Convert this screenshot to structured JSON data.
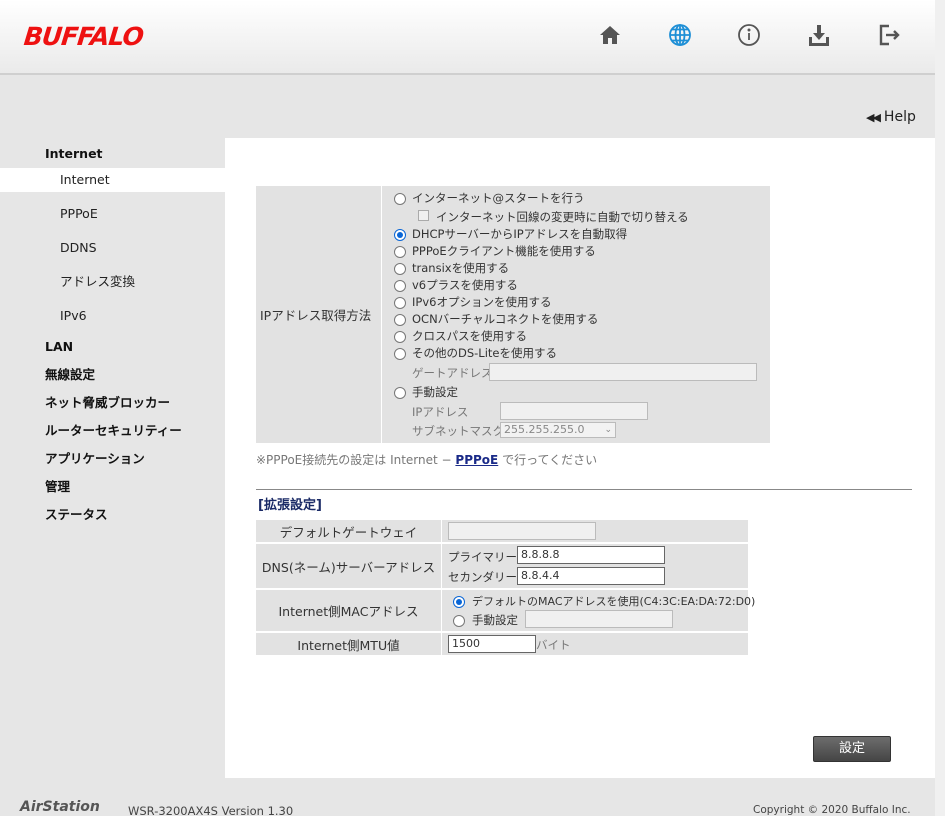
{
  "header": {
    "logo": "BUFFALO",
    "icons": [
      {
        "name": "home-icon"
      },
      {
        "name": "globe-icon",
        "color": "#1e8fd6"
      },
      {
        "name": "info-icon"
      },
      {
        "name": "download-icon"
      },
      {
        "name": "logout-icon"
      }
    ]
  },
  "help": {
    "label": "Help"
  },
  "sidebar": {
    "sections": [
      {
        "label": "Internet"
      },
      {
        "label": "LAN"
      },
      {
        "label": "無線設定"
      },
      {
        "label": "ネット脅威ブロッカー"
      },
      {
        "label": "ルーターセキュリティー"
      },
      {
        "label": "アプリケーション"
      },
      {
        "label": "管理"
      },
      {
        "label": "ステータス"
      }
    ],
    "internet_items": [
      {
        "label": "Internet",
        "active": true
      },
      {
        "label": "PPPoE"
      },
      {
        "label": "DDNS"
      },
      {
        "label": "アドレス変換"
      },
      {
        "label": "IPv6"
      }
    ]
  },
  "ip_method": {
    "label": "IPアドレス取得方法",
    "options": [
      {
        "label": "インターネット@スタートを行う",
        "selected": false
      },
      {
        "label": "DHCPサーバーからIPアドレスを自動取得",
        "selected": true
      },
      {
        "label": "PPPoEクライアント機能を使用する",
        "selected": false
      },
      {
        "label": "transixを使用する",
        "selected": false
      },
      {
        "label": "v6プラスを使用する",
        "selected": false
      },
      {
        "label": "IPv6オプションを使用する",
        "selected": false
      },
      {
        "label": "OCNバーチャルコネクトを使用する",
        "selected": false
      },
      {
        "label": "クロスパスを使用する",
        "selected": false
      },
      {
        "label": "その他のDS-Liteを使用する",
        "selected": false
      },
      {
        "label": "手動設定",
        "selected": false
      }
    ],
    "auto_switch_label": "インターネット回線の変更時に自動で切り替える",
    "gateway_label": "ゲートアドレス",
    "gateway_value": "",
    "ip_label": "IPアドレス",
    "ip_value": "",
    "subnet_label": "サブネットマスク",
    "subnet_value": "255.255.255.0"
  },
  "note": {
    "prefix": "※PPPoE接続先の設定は Internet − ",
    "link": "PPPoE",
    "suffix": " で行ってください"
  },
  "extended": {
    "title": "[拡張設定]",
    "default_gateway_label": "デフォルトゲートウェイ",
    "default_gateway_value": "",
    "dns_label": "DNS(ネーム)サーバーアドレス",
    "primary_label": "プライマリー:",
    "primary_value": "8.8.8.8",
    "secondary_label": "セカンダリー:",
    "secondary_value": "8.8.4.4",
    "mac_label": "Internet側MACアドレス",
    "mac_default_label": "デフォルトのMACアドレスを使用(C4:3C:EA:DA:72:D0)",
    "mac_default_selected": true,
    "mac_manual_label": "手動設定",
    "mac_manual_value": "",
    "mtu_label": "Internet側MTU値",
    "mtu_value": "1500",
    "mtu_unit": "バイト"
  },
  "submit_button": "設定",
  "footer": {
    "brand": "AirStation",
    "model": "WSR-3200AX4S   Version 1.30",
    "copyright": "Copyright © 2020 Buffalo Inc."
  }
}
